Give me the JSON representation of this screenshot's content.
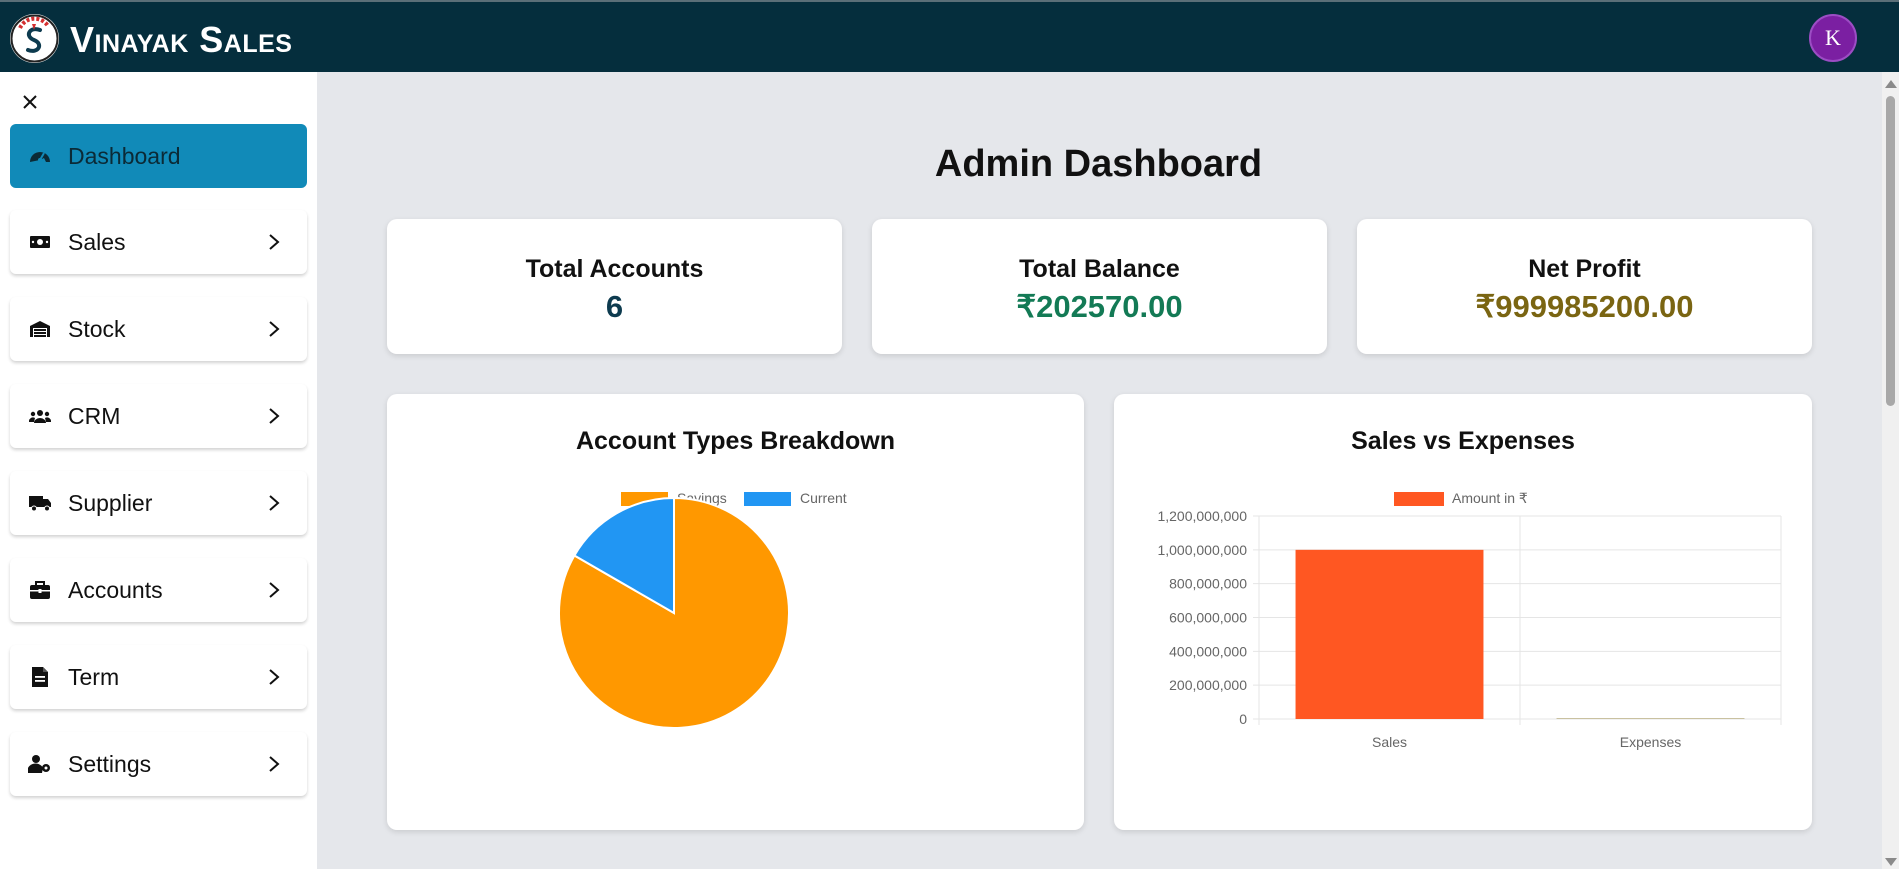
{
  "header": {
    "brand_first": "V",
    "brand_first_rest": "inayak",
    "brand_second": "S",
    "brand_second_rest": "ales",
    "avatar_letter": "K"
  },
  "sidebar": {
    "items": [
      {
        "label": "Dashboard",
        "icon": "gauge-icon",
        "active": true
      },
      {
        "label": "Sales",
        "icon": "money-bill-icon"
      },
      {
        "label": "Stock",
        "icon": "warehouse-icon"
      },
      {
        "label": "CRM",
        "icon": "users-icon"
      },
      {
        "label": "Supplier",
        "icon": "truck-icon"
      },
      {
        "label": "Accounts",
        "icon": "briefcase-icon"
      },
      {
        "label": "Term",
        "icon": "file-icon"
      },
      {
        "label": "Settings",
        "icon": "user-gear-icon"
      }
    ]
  },
  "main": {
    "title": "Admin Dashboard",
    "stats": [
      {
        "title": "Total Accounts",
        "value": "6",
        "color": "#0d3b4f"
      },
      {
        "title": "Total Balance",
        "value": "₹202570.00",
        "color": "#137a55"
      },
      {
        "title": "Net Profit",
        "value": "₹999985200.00",
        "color": "#7a6512"
      }
    ]
  },
  "colors": {
    "header_bg": "#052e3d",
    "active_nav": "#118ab8",
    "savings": "#ff9800",
    "current": "#2196f3",
    "bar": "#ff5722"
  },
  "chart_data": [
    {
      "type": "pie",
      "title": "Account Types Breakdown",
      "categories": [
        "Savings",
        "Current"
      ],
      "values": [
        5,
        1
      ],
      "colors": [
        "#ff9800",
        "#2196f3"
      ],
      "legend": "top"
    },
    {
      "type": "bar",
      "title": "Sales vs Expenses",
      "categories": [
        "Sales",
        "Expenses"
      ],
      "series": [
        {
          "name": "Amount in ₹",
          "values": [
            1000000000,
            14800
          ]
        }
      ],
      "ylim": [
        0,
        1200000000
      ],
      "yticks": [
        0,
        200000000,
        400000000,
        600000000,
        800000000,
        1000000000,
        1200000000
      ],
      "ytick_labels": [
        "0",
        "200,000,000",
        "400,000,000",
        "600,000,000",
        "800,000,000",
        "1,000,000,000",
        "1,200,000,000"
      ],
      "grid": true,
      "legend": "top"
    }
  ]
}
